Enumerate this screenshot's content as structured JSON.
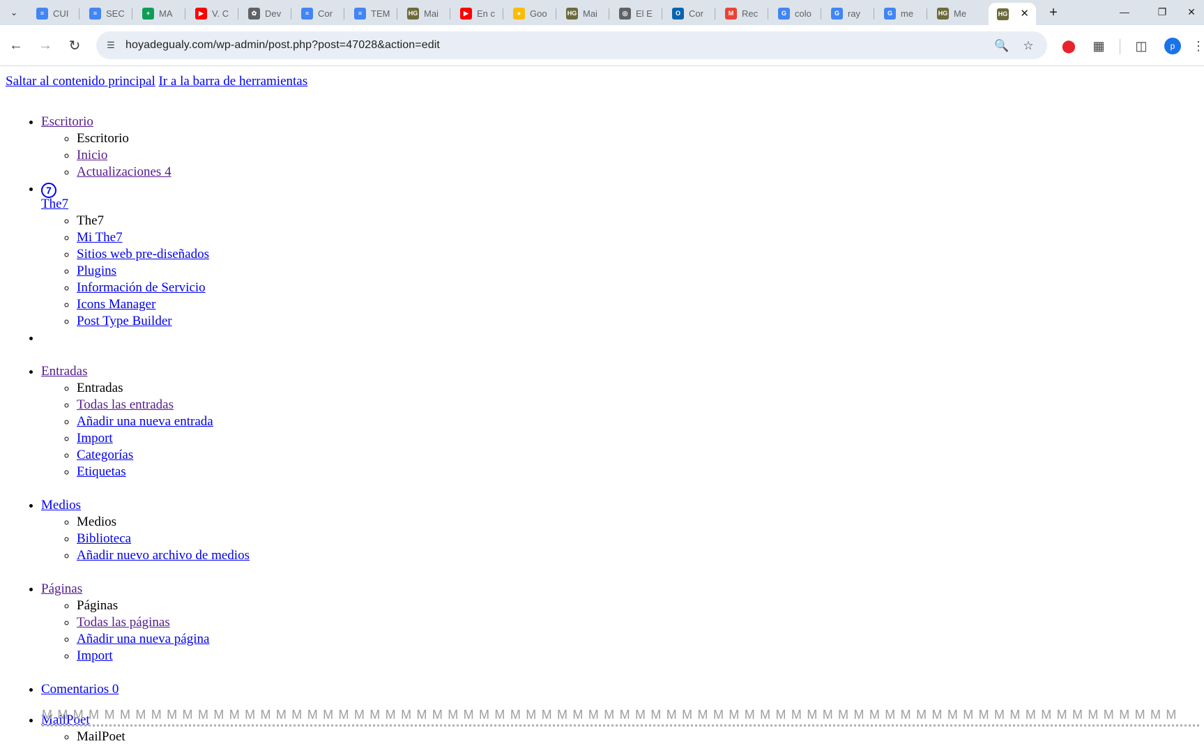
{
  "browser": {
    "tabs": [
      {
        "label": "CUI",
        "icon": "docs-icon",
        "color": "#4285f4"
      },
      {
        "label": "SEC",
        "icon": "docs-icon",
        "color": "#4285f4"
      },
      {
        "label": "MA",
        "icon": "sheets-icon",
        "color": "#0f9d58"
      },
      {
        "label": "V. C",
        "icon": "youtube-icon",
        "color": "#ff0000"
      },
      {
        "label": "Dev",
        "icon": "chatgpt-icon",
        "color": "#5f6368"
      },
      {
        "label": "Cor",
        "icon": "docs-icon",
        "color": "#4285f4"
      },
      {
        "label": "TEM",
        "icon": "docs-icon",
        "color": "#4285f4"
      },
      {
        "label": "Mai",
        "icon": "hg-icon",
        "color": "#6b6a3a"
      },
      {
        "label": "En c",
        "icon": "youtube-icon",
        "color": "#ff0000"
      },
      {
        "label": "Goo",
        "icon": "keep-icon",
        "color": "#fbbc04"
      },
      {
        "label": "Mai",
        "icon": "hg-icon",
        "color": "#6b6a3a"
      },
      {
        "label": "El E",
        "icon": "globe-icon",
        "color": "#5f6368"
      },
      {
        "label": "Cor",
        "icon": "outlook-icon",
        "color": "#0a64ad"
      },
      {
        "label": "Rec",
        "icon": "gmail-icon",
        "color": "#ea4335"
      },
      {
        "label": "colo",
        "icon": "google-icon",
        "color": "#4285f4"
      },
      {
        "label": "ray",
        "icon": "google-icon",
        "color": "#4285f4"
      },
      {
        "label": "me",
        "icon": "google-icon",
        "color": "#4285f4"
      },
      {
        "label": "Me",
        "icon": "hg-icon",
        "color": "#6b6a3a"
      }
    ],
    "active_tab_icon": "hg-icon",
    "active_tab_color": "#6b6a3a",
    "url": "hoyadegualy.com/wp-admin/post.php?post=47028&action=edit",
    "avatar_letter": "p"
  },
  "page": {
    "skip_main": "Saltar al contenido principal",
    "skip_toolbar": "Ir a la barra de herramientas",
    "menu": {
      "escritorio": {
        "label": "Escritorio",
        "sub": [
          "Escritorio",
          "Inicio",
          "Actualizaciones 4"
        ]
      },
      "the7": {
        "icon_glyph": "7",
        "label": "The7",
        "sub": [
          "The7",
          "Mi The7",
          "Sitios web pre-diseñados",
          "Plugins",
          "Información de Servicio",
          "Icons Manager",
          "Post Type Builder"
        ]
      },
      "entradas": {
        "label": "Entradas",
        "sub": [
          "Entradas",
          "Todas las entradas",
          "Añadir una nueva entrada",
          "Import",
          "Categorías",
          "Etiquetas"
        ]
      },
      "medios": {
        "label": "Medios",
        "sub": [
          "Medios",
          "Biblioteca",
          "Añadir nuevo archivo de medios"
        ]
      },
      "paginas": {
        "label": "Páginas",
        "sub": [
          "Páginas",
          "Todas las páginas",
          "Añadir una nueva página",
          "Import"
        ]
      },
      "comentarios": {
        "label": "Comentarios 0"
      },
      "mailpoet": {
        "logo_strip": "MMMMMMMMMMMMMMMMMMMMMMMMMMMMMMMMMMMMMMMMMMMMMMMMMMMMMMMMMMMMMMMMMMMMMMMMM",
        "label": "MailPoet",
        "sub": [
          "MailPoet"
        ]
      }
    }
  },
  "colors": {
    "link": "#0000ee",
    "visited": "#551a8b",
    "tabstrip_bg": "#dde3ea",
    "omnibox_bg": "#e9eef6"
  }
}
